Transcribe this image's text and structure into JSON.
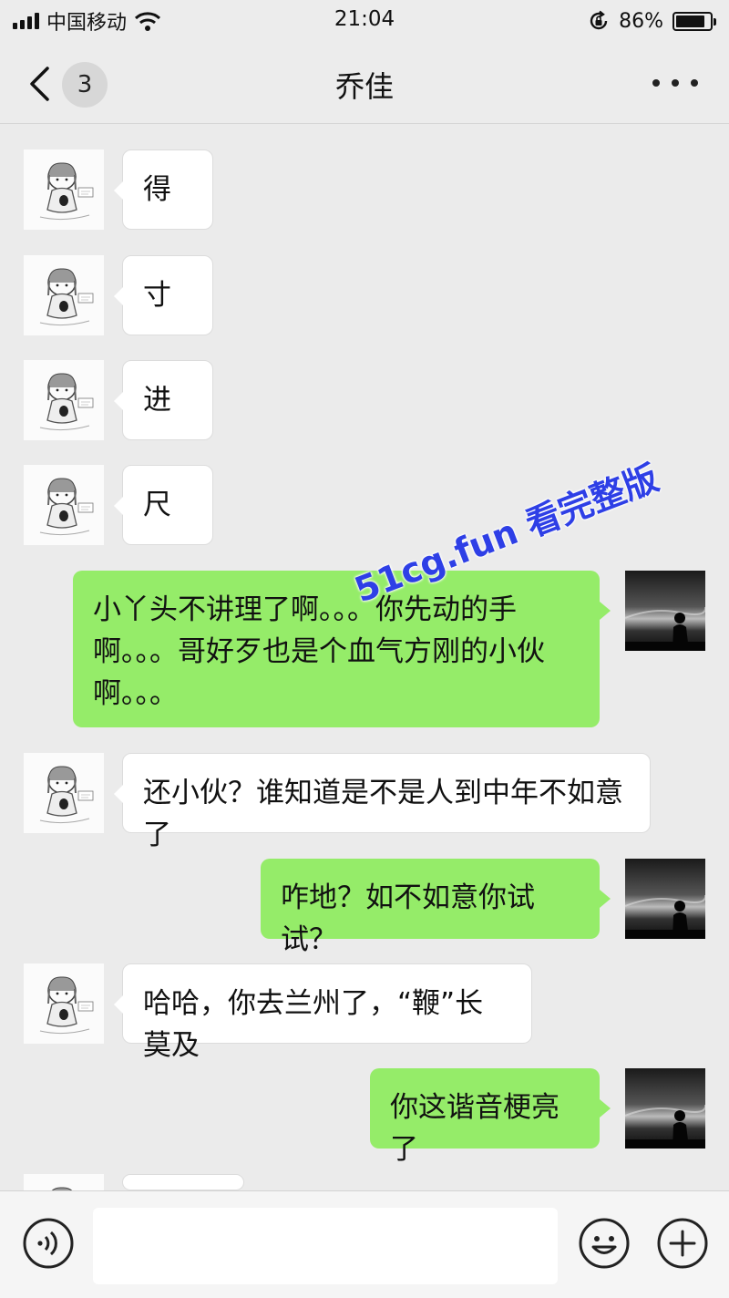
{
  "status_bar": {
    "carrier": "中国移动",
    "time": "21:04",
    "battery_percent_text": "86%",
    "battery_level": 0.86,
    "icons": [
      "signal-icon",
      "wifi-icon",
      "rotation-lock-icon",
      "battery-icon"
    ]
  },
  "nav": {
    "unread_count": "3",
    "title": "乔佳",
    "icons": [
      "back-chevron-icon",
      "more-dots-icon"
    ]
  },
  "messages": [
    {
      "side": "left",
      "text": "得"
    },
    {
      "side": "left",
      "text": "寸"
    },
    {
      "side": "left",
      "text": "进"
    },
    {
      "side": "left",
      "text": "尺"
    },
    {
      "side": "right",
      "text": "小丫头不讲理了啊。。。你先动的手啊。。。哥好歹也是个血气方刚的小伙啊。。。"
    },
    {
      "side": "left",
      "text": "还小伙？谁知道是不是人到中年不如意了"
    },
    {
      "side": "right",
      "text": "咋地？如不如意你试试？"
    },
    {
      "side": "left",
      "text": "哈哈，你去兰州了，“鞭”长莫及"
    },
    {
      "side": "right",
      "text": "你这谐音梗亮了"
    }
  ],
  "watermark": "51cg.fun 看完整版",
  "input_bar": {
    "text_value": "",
    "icons": [
      "voice-icon",
      "emoji-icon",
      "plus-icon"
    ]
  },
  "colors": {
    "background": "#ebebeb",
    "bar": "#ececec",
    "bubble_out": "#95ec69",
    "bubble_in": "#ffffff",
    "watermark": "#2e3fe6"
  }
}
